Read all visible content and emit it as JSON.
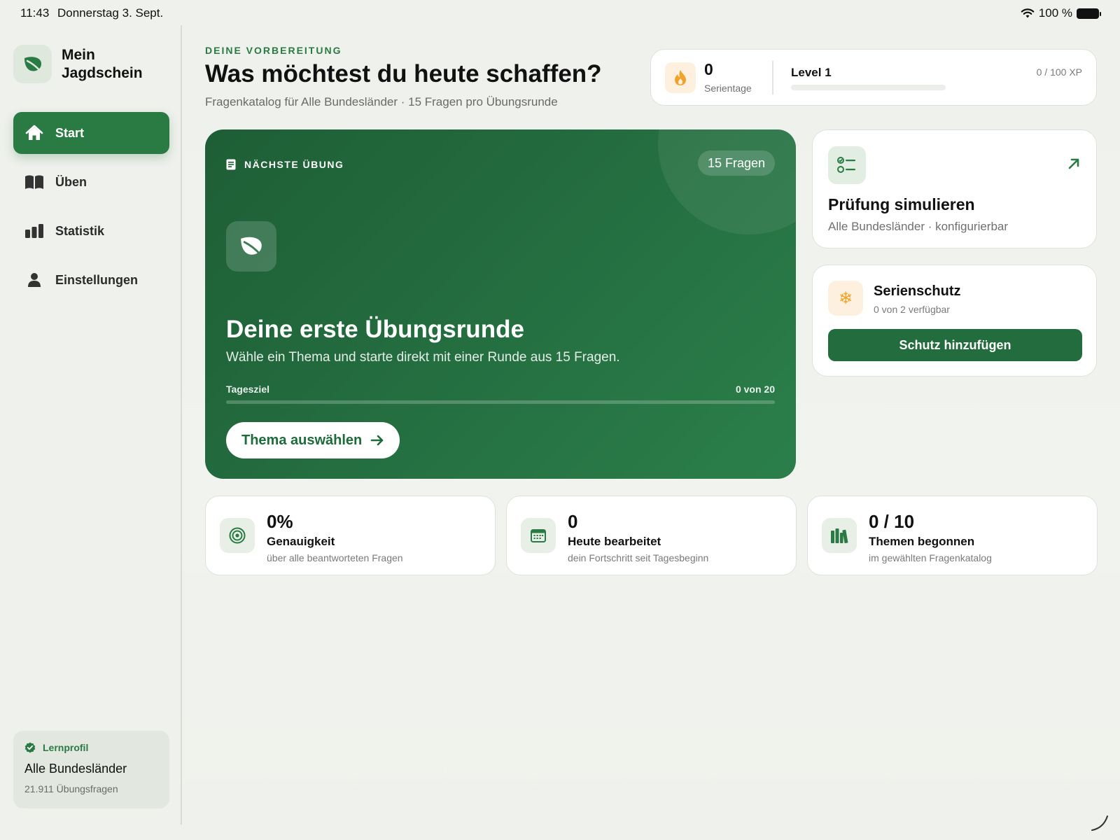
{
  "status_bar": {
    "time": "11:43",
    "date": "Donnerstag 3. Sept.",
    "battery": "100 %"
  },
  "sidebar": {
    "brand": "Mein Jagdschein",
    "items": [
      {
        "label": "Start",
        "icon": "home-icon",
        "active": true
      },
      {
        "label": "Üben",
        "icon": "book-icon",
        "active": false
      },
      {
        "label": "Statistik",
        "icon": "bar-chart-icon",
        "active": false
      },
      {
        "label": "Einstellungen",
        "icon": "person-icon",
        "active": false
      }
    ],
    "profile": {
      "heading": "Lernprofil",
      "title": "Alle Bundesländer",
      "subtitle": "21.911 Übungsfragen"
    }
  },
  "header": {
    "eyebrow": "DEINE VORBEREITUNG",
    "title": "Was möchtest du heute schaffen?",
    "subtitle": "Fragenkatalog für Alle Bundesländer · 15 Fragen pro Übungsrunde"
  },
  "progress": {
    "streak_value": "0",
    "streak_label": "Serientage",
    "level_label": "Level 1",
    "xp_label": "0 / 100 XP",
    "xp_fraction": 0
  },
  "hero": {
    "eyebrow": "NÄCHSTE ÜBUNG",
    "badge": "15 Fragen",
    "title": "Deine erste Übungsrunde",
    "subtitle": "Wähle ein Thema und starte direkt mit einer Runde aus 15 Fragen.",
    "goal_label": "Tagesziel",
    "goal_count": "0 von 20",
    "goal_fraction": 0,
    "button": "Thema auswählen"
  },
  "exam": {
    "title": "Prüfung simulieren",
    "subtitle": "Alle Bundesländer · konfigurierbar"
  },
  "protect": {
    "title": "Serienschutz",
    "subtitle": "0 von 2 verfügbar",
    "button": "Schutz hinzufügen"
  },
  "stats": [
    {
      "value": "0%",
      "label": "Genauigkeit",
      "sub": "über alle beantworteten Fragen",
      "icon": "target-icon"
    },
    {
      "value": "0",
      "label": "Heute bearbeitet",
      "sub": "dein Fortschritt seit Tagesbeginn",
      "icon": "calendar-icon"
    },
    {
      "value": "0 / 10",
      "label": "Themen begonnen",
      "sub": "im gewählten Fragenkatalog",
      "icon": "books-icon"
    }
  ],
  "colors": {
    "accent": "#2a7a43",
    "hero_dark": "#1e5e36",
    "flame": "#f0a32a"
  }
}
